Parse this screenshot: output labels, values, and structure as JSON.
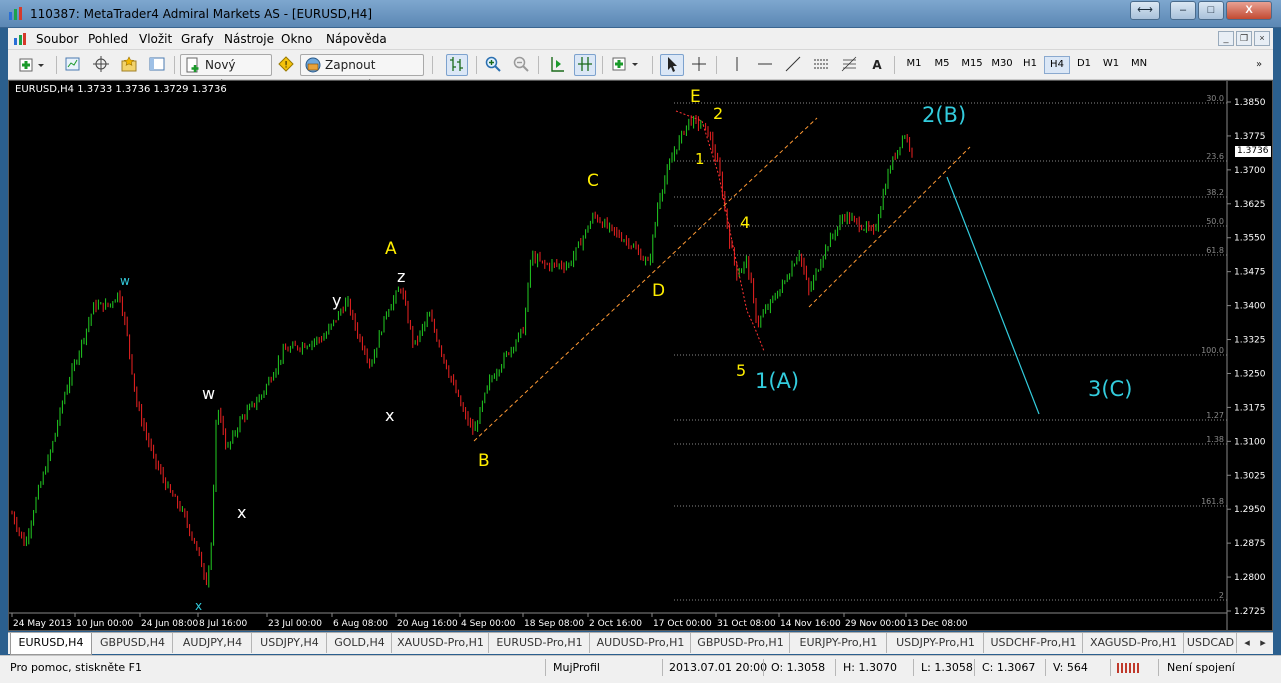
{
  "window": {
    "title": "110387: MetaTrader4 Admiral Markets AS - [EURUSD,H4]",
    "controls": [
      "⟷",
      "–",
      "□",
      "X"
    ]
  },
  "menu": {
    "items": [
      "Soubor",
      "Pohled",
      "Vložit",
      "Grafy",
      "Nástroje",
      "Okno",
      "Nápověda"
    ]
  },
  "toolbar": {
    "new_order": "Nový pokyn",
    "autotrading": "Zapnout strategie",
    "a_tool": "A",
    "timeframes": [
      "M1",
      "M5",
      "M15",
      "M30",
      "H1",
      "H4",
      "D1",
      "W1",
      "MN"
    ],
    "active_timeframe": "H4"
  },
  "chart": {
    "header": "EURUSD,H4  1.3733 1.3736 1.3729 1.3736",
    "current_price": "1.3736",
    "price_labels": [
      "1.3850",
      "1.3775",
      "1.3700",
      "1.3625",
      "1.3550",
      "1.3475",
      "1.3400",
      "1.3325",
      "1.3250",
      "1.3175",
      "1.3100",
      "1.3025",
      "1.2950",
      "1.2875",
      "1.2800",
      "1.2725"
    ],
    "fib_labels": [
      "30.0",
      "23.6",
      "38.2",
      "50.0",
      "61.8",
      "100.0",
      "1.27",
      "1.38",
      "161.8",
      "2"
    ],
    "time_labels": [
      "24 May 2013",
      "10 Jun 00:00",
      "24 Jun 08:00",
      "8 Jul 16:00",
      "23 Jul 00:00",
      "6 Aug 08:00",
      "20 Aug 16:00",
      "4 Sep 00:00",
      "18 Sep 08:00",
      "2 Oct 16:00",
      "17 Oct 00:00",
      "31 Oct 08:00",
      "14 Nov 16:00",
      "29 Nov 00:00",
      "13 Dec 08:00"
    ],
    "wave_labels": {
      "w1": "w",
      "x1": "x",
      "w2": "w",
      "x2": "x",
      "y": "y",
      "x3": "x",
      "A": "A",
      "z": "z",
      "B": "B",
      "C": "C",
      "D": "D",
      "E": "E",
      "n1": "1",
      "n2": "2",
      "n4": "4",
      "n5": "5",
      "wA": "1(A)",
      "wB": "2(B)",
      "wC": "3(C)"
    },
    "colors": {
      "bull": "#22cc22",
      "bear": "#ee2222",
      "wave_yellow": "#ffee00",
      "wave_cyan": "#33ccdd",
      "wave_white": "#ffffff",
      "channel": "#ff9933",
      "fib": "#888888"
    }
  },
  "tabs": [
    "EURUSD,H4",
    "GBPUSD,H4",
    "AUDJPY,H4",
    "USDJPY,H4",
    "GOLD,H4",
    "XAUUSD-Pro,H1",
    "EURUSD-Pro,H1",
    "AUDUSD-Pro,H1",
    "GBPUSD-Pro,H1",
    "EURJPY-Pro,H1",
    "USDJPY-Pro,H1",
    "USDCHF-Pro,H1",
    "XAGUSD-Pro,H1",
    "USDCAD"
  ],
  "status": {
    "help": "Pro pomoc, stiskněte F1",
    "profile": "MujProfil",
    "datetime": "2013.07.01 20:00",
    "open": "O: 1.3058",
    "high": "H: 1.3070",
    "low": "L: 1.3058",
    "close": "C: 1.3067",
    "volume": "V: 564",
    "connection": "Není spojení"
  }
}
